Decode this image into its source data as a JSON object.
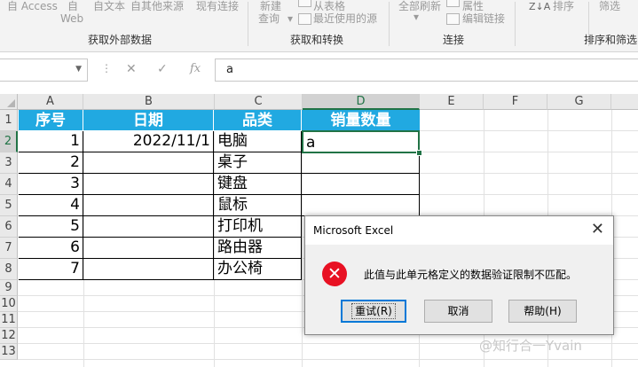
{
  "ribbon": {
    "row1": {
      "from_access": "自 Access",
      "from_web_top": "自",
      "from_text": "自文本",
      "from_other": "自其他来源",
      "existing_conn": "现有连接",
      "new_query_top": "新建",
      "from_table": "从表格",
      "refresh_all": "全部刷新",
      "properties": "属性",
      "sort": "排序",
      "filter": "筛选"
    },
    "row2": {
      "from_web_bottom": "Web",
      "new_query_bottom": "查询",
      "recent_sources": "最近使用的源",
      "edit_links": "编辑链接"
    },
    "groups": {
      "get_external": "获取外部数据",
      "get_transform": "获取和转换",
      "connections": "连接",
      "sort_filter": "排序和筛选"
    },
    "sort_az_icon": "Z↓A"
  },
  "formula_bar": {
    "name_box_value": "",
    "cancel_icon": "✕",
    "enter_icon": "✓",
    "fx_label": "fx",
    "formula_value": "a"
  },
  "columns": [
    "A",
    "B",
    "C",
    "D",
    "E",
    "F",
    "G"
  ],
  "rows": [
    "1",
    "2",
    "3",
    "4",
    "5",
    "6",
    "7",
    "8",
    "9",
    "10",
    "11",
    "12",
    "13"
  ],
  "table": {
    "headers": [
      "序号",
      "日期",
      "品类",
      "销量数量"
    ],
    "rows": [
      {
        "no": "1",
        "date": "2022/11/1",
        "category": "电脑",
        "qty": "a"
      },
      {
        "no": "2",
        "date": "",
        "category": "桌子",
        "qty": ""
      },
      {
        "no": "3",
        "date": "",
        "category": "键盘",
        "qty": ""
      },
      {
        "no": "4",
        "date": "",
        "category": "鼠标",
        "qty": ""
      },
      {
        "no": "5",
        "date": "",
        "category": "打印机",
        "qty": ""
      },
      {
        "no": "6",
        "date": "",
        "category": "路由器",
        "qty": ""
      },
      {
        "no": "7",
        "date": "",
        "category": "办公椅",
        "qty": ""
      }
    ]
  },
  "active_cell_value": "a",
  "dialog": {
    "title": "Microsoft Excel",
    "message": "此值与此单元格定义的数据验证限制不匹配。",
    "buttons": {
      "retry": "重试(R)",
      "cancel": "取消",
      "help": "帮助(H)"
    }
  },
  "watermark": "@知行合一Yvain",
  "colors": {
    "header_bg": "#21a9e1",
    "excel_green": "#217346",
    "error_red": "#e81123",
    "focus_blue": "#0078d7"
  }
}
